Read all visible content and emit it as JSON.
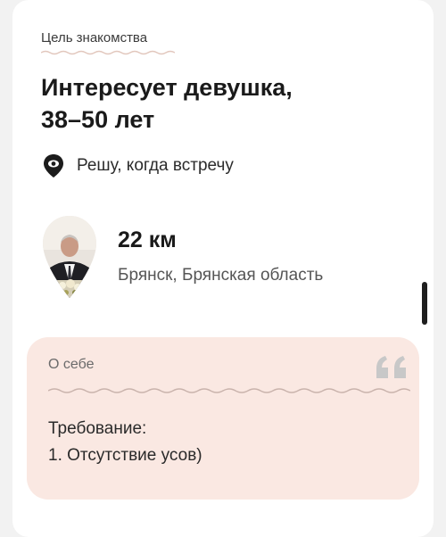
{
  "goal": {
    "label": "Цель знакомства",
    "title_line1": "Интересует девушка,",
    "title_line2": "38–50 лет"
  },
  "meeting": {
    "icon": "location-pin-icon",
    "text": "Решу, когда встречу"
  },
  "location": {
    "distance": "22 км",
    "city": "Брянск, Брянская область"
  },
  "about": {
    "label": "О себе",
    "icon": "quote-icon",
    "lines": [
      "Требование:",
      "1. Отсутствие усов)"
    ]
  },
  "colors": {
    "about_background": "#fae8e2",
    "accent_pink": "#e8c4bb",
    "quote_gray": "#c8c8c8"
  }
}
